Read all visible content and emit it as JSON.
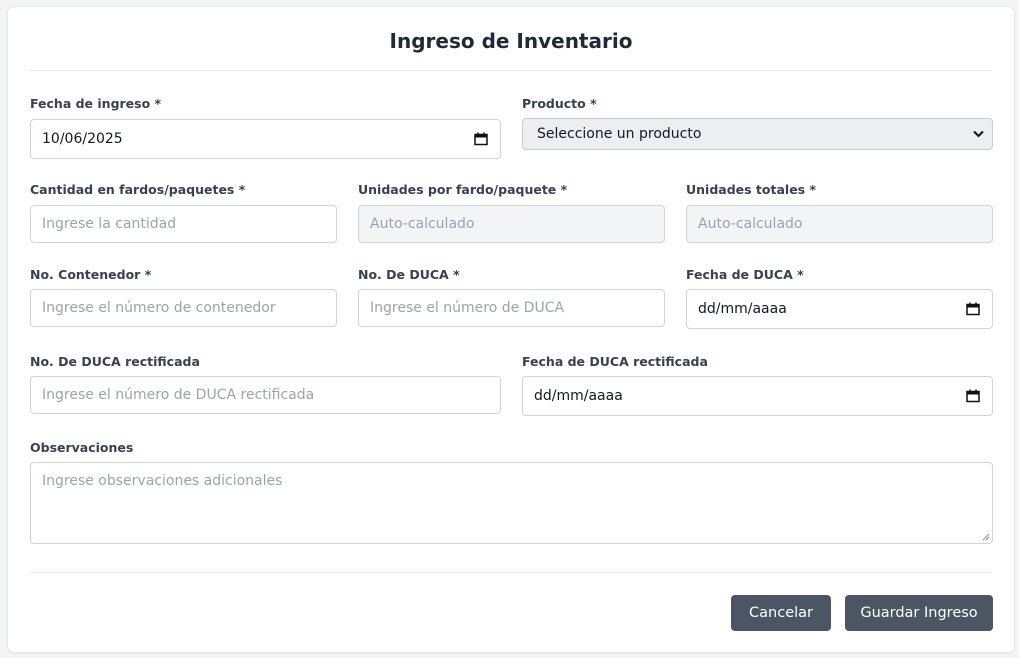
{
  "form": {
    "title": "Ingreso de Inventario",
    "fecha_ingreso": {
      "label": "Fecha de ingreso *",
      "value": "10/06/2025"
    },
    "producto": {
      "label": "Producto *",
      "selected": "Seleccione un producto"
    },
    "cantidad": {
      "label": "Cantidad en fardos/paquetes *",
      "placeholder": "Ingrese la cantidad"
    },
    "unidades_fardo": {
      "label": "Unidades por fardo/paquete *",
      "placeholder": "Auto-calculado"
    },
    "unidades_totales": {
      "label": "Unidades totales *",
      "placeholder": "Auto-calculado"
    },
    "contenedor": {
      "label": "No. Contenedor *",
      "placeholder": "Ingrese el número de contenedor"
    },
    "duca": {
      "label": "No. De DUCA *",
      "placeholder": "Ingrese el número de DUCA"
    },
    "fecha_duca": {
      "label": "Fecha de DUCA *",
      "value": "dd/mm/aaaa"
    },
    "duca_rect": {
      "label": "No. De DUCA rectificada",
      "placeholder": "Ingrese el número de DUCA rectificada"
    },
    "fecha_duca_rect": {
      "label": "Fecha de DUCA rectificada",
      "value": "dd/mm/aaaa"
    },
    "observaciones": {
      "label": "Observaciones",
      "placeholder": "Ingrese observaciones adicionales"
    },
    "buttons": {
      "cancel": "Cancelar",
      "save": "Guardar Ingreso"
    }
  },
  "colors": {
    "button_bg": "#4b5563",
    "readonly_bg": "#f3f4f6",
    "border": "#d1d5db"
  }
}
